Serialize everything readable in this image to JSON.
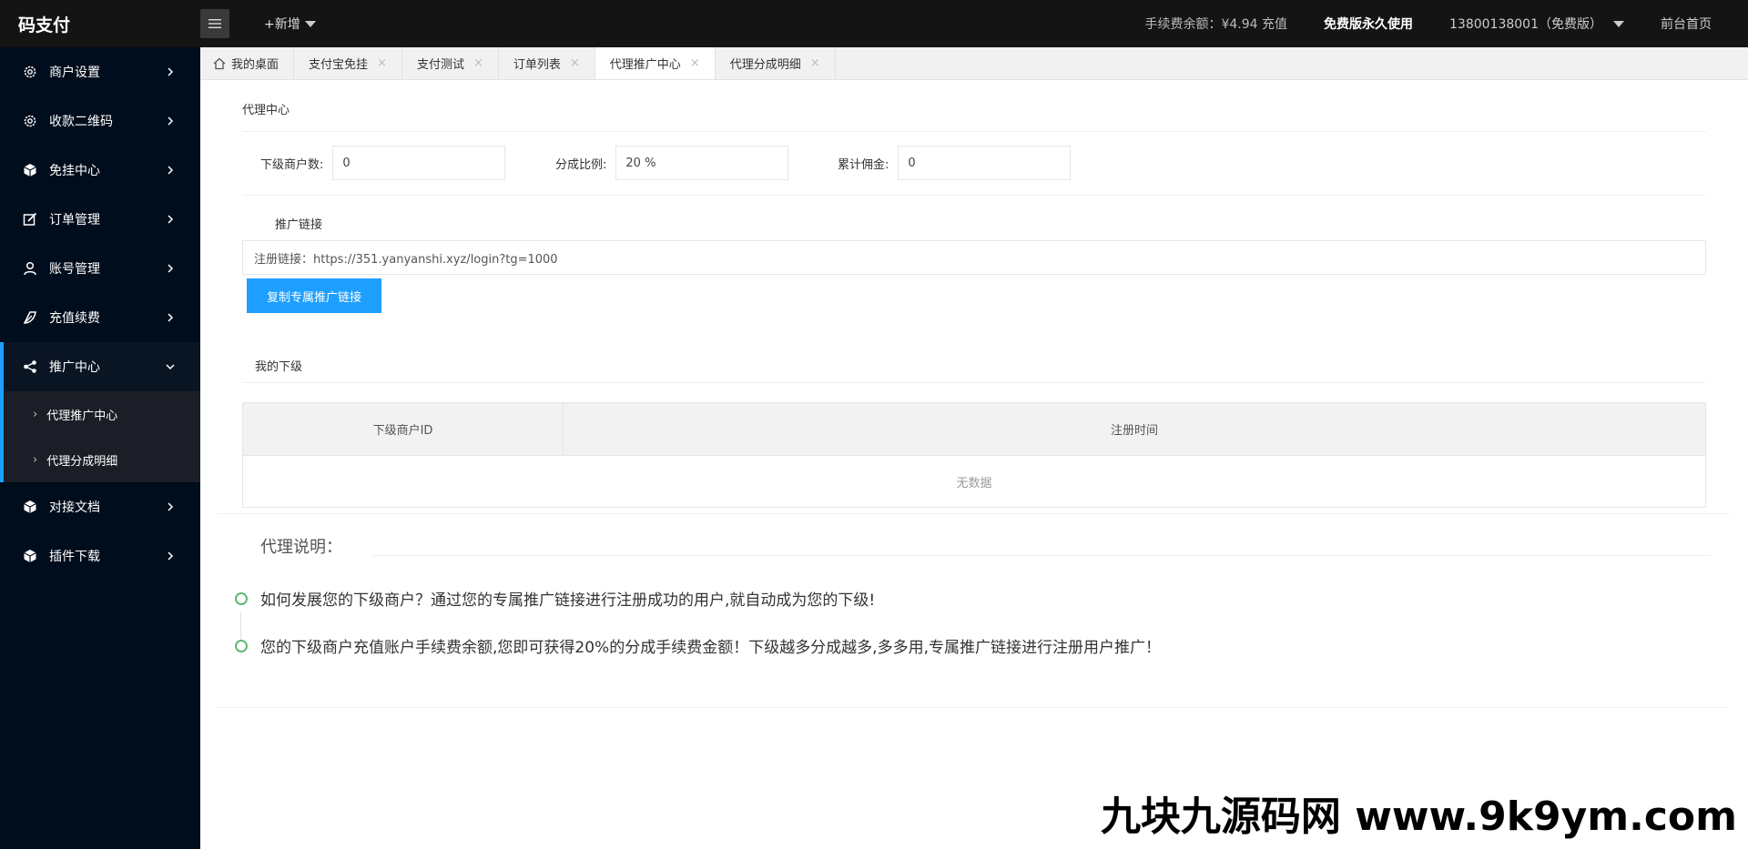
{
  "app": {
    "logo": "码支付"
  },
  "header": {
    "new_label": "+新增",
    "fee_balance": "手续费余额：¥4.94 充值",
    "free_label": "免费版永久使用",
    "account": "13800138001（免费版）",
    "home_link": "前台首页"
  },
  "sidebar": {
    "items": [
      {
        "label": "商户设置",
        "icon": "gear-icon"
      },
      {
        "label": "收款二维码",
        "icon": "gear-icon"
      },
      {
        "label": "免挂中心",
        "icon": "cube-icon"
      },
      {
        "label": "订单管理",
        "icon": "edit-icon"
      },
      {
        "label": "账号管理",
        "icon": "user-icon"
      },
      {
        "label": "充值续费",
        "icon": "leaf-icon"
      },
      {
        "label": "推广中心",
        "icon": "share-icon"
      },
      {
        "label": "对接文档",
        "icon": "cube-icon"
      },
      {
        "label": "插件下载",
        "icon": "cube-icon"
      }
    ],
    "sub_items": [
      {
        "label": "代理推广中心"
      },
      {
        "label": "代理分成明细"
      }
    ]
  },
  "tabs": [
    {
      "label": "我的桌面"
    },
    {
      "label": "支付宝免挂"
    },
    {
      "label": "支付测试"
    },
    {
      "label": "订单列表"
    },
    {
      "label": "代理推广中心"
    },
    {
      "label": "代理分成明细"
    }
  ],
  "main": {
    "card_title": "代理中心",
    "stats": [
      {
        "label": "下级商户数:",
        "value": "0"
      },
      {
        "label": "分成比例:",
        "value": "20 %"
      },
      {
        "label": "累计佣金:",
        "value": "0"
      }
    ],
    "link_label": "推广链接",
    "link_text": "注册链接：https://351.yanyanshi.xyz/login?tg=1000",
    "copy_button": "复制专属推广链接",
    "subordinates_title": "我的下级",
    "table": {
      "headers": [
        "下级商户ID",
        "注册时间"
      ],
      "empty": "无数据"
    },
    "explain": {
      "legend": "代理说明：",
      "items": [
        "如何发展您的下级商户？通过您的专属推广链接进行注册成功的用户,就自动成为您的下级!",
        "您的下级商户充值账户手续费余额,您即可获得20%的分成手续费金额！下级越多分成越多,多多用,专属推广链接进行注册用户推广！"
      ]
    }
  },
  "watermark": "九块九源码网 www.9k9ym.com",
  "colors": {
    "accent": "#1e9fff",
    "sidebar_bg": "#000d1c",
    "header_bg": "#141414",
    "timeline": "#5fb878"
  }
}
